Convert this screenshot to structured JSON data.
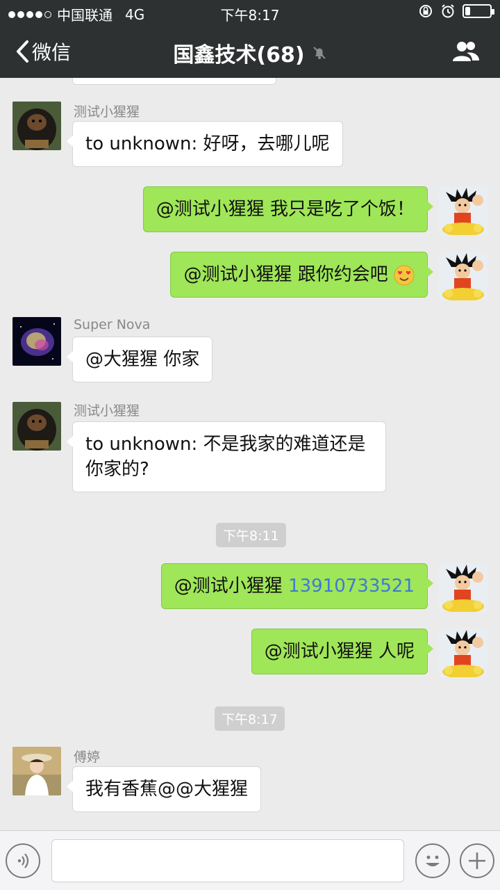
{
  "status_bar": {
    "carrier": "中国联通",
    "network": "4G",
    "time": "下午8:17",
    "signal_dots_filled": 4,
    "signal_dots_total": 5,
    "battery_level": 0.2
  },
  "nav": {
    "back_label": "微信",
    "title": "国鑫技术(68)",
    "muted_icon": "bell-slash-icon",
    "members_icon": "group-icon"
  },
  "messages": [
    {
      "dir": "in",
      "sender": "测试小猩猩",
      "text": "to unknown: 好呀，去哪儿呢",
      "avatar": "gorilla-avatar"
    },
    {
      "dir": "out",
      "text": "@测试小猩猩 我只是吃了个饭！",
      "avatar": "goku-avatar"
    },
    {
      "dir": "out",
      "text": "@测试小猩猩 跟你约会吧",
      "emoji": "heart-eyes-emoji",
      "avatar": "goku-avatar"
    },
    {
      "dir": "in",
      "sender": "Super Nova",
      "text": "@大猩猩 你家",
      "avatar": "nebula-avatar"
    },
    {
      "dir": "in",
      "sender": "测试小猩猩",
      "line1": "to unknown: 不是我家的难道还是",
      "line2": "你家的?",
      "avatar": "gorilla-avatar"
    },
    {
      "timestamp": "下午8:11"
    },
    {
      "dir": "out",
      "prefix": "@测试小猩猩 ",
      "phone": "13910733521",
      "avatar": "goku-avatar"
    },
    {
      "dir": "out",
      "text": "@测试小猩猩 人呢",
      "avatar": "goku-avatar"
    },
    {
      "timestamp": "下午8:17"
    },
    {
      "dir": "in",
      "sender": "傅婷",
      "text": "我有香蕉@@大猩猩",
      "avatar": "woman-avatar"
    }
  ],
  "input_bar": {
    "voice_icon": "voice-icon",
    "emoji_icon": "smiley-icon",
    "plus_icon": "plus-icon",
    "text_value": ""
  },
  "colors": {
    "header_bg": "#2e3132",
    "chat_bg": "#ebebeb",
    "out_bubble": "#9fe658",
    "in_bubble": "#ffffff",
    "link_blue": "#3d7ad6"
  }
}
